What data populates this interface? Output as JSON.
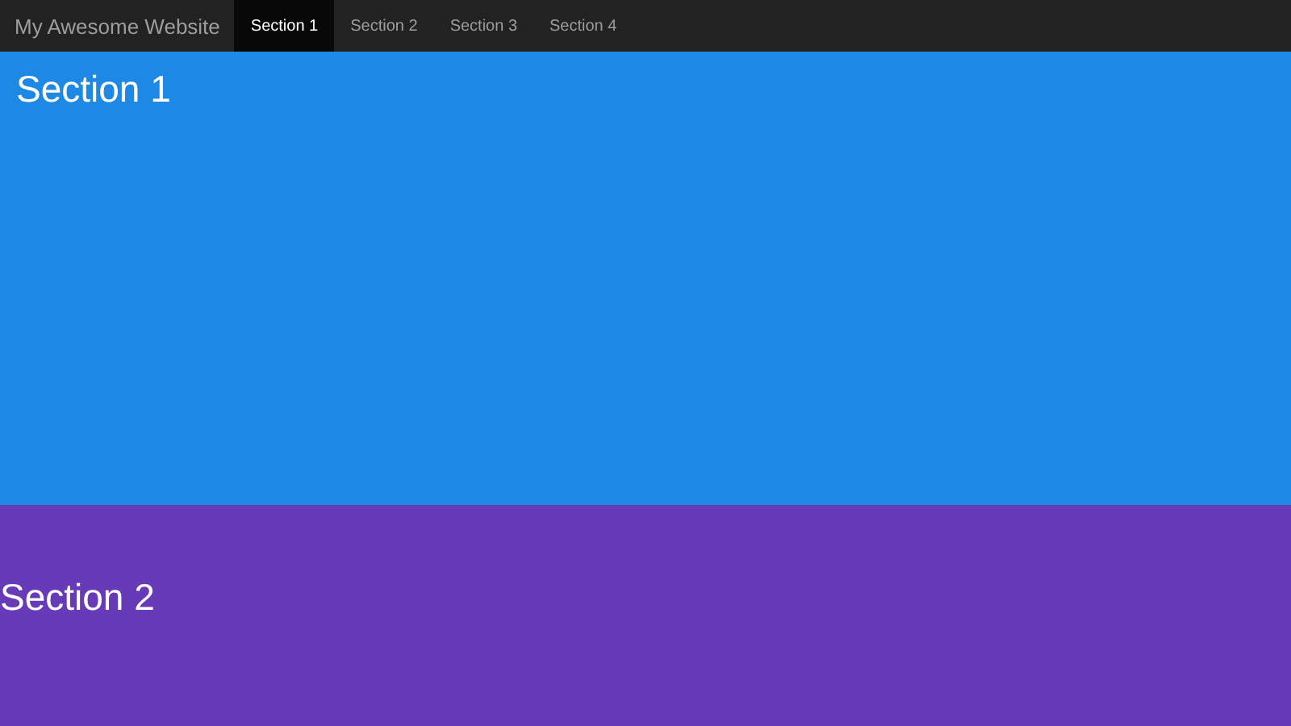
{
  "navbar": {
    "brand": "My Awesome Website",
    "items": [
      {
        "label": "Section 1",
        "selected": true
      },
      {
        "label": "Section 2",
        "selected": false
      },
      {
        "label": "Section 3",
        "selected": false
      },
      {
        "label": "Section 4",
        "selected": false
      }
    ]
  },
  "sections": [
    {
      "heading": "Section 1",
      "color": "#1e88e5"
    },
    {
      "heading": "Section 2",
      "color": "#673ab7"
    }
  ]
}
